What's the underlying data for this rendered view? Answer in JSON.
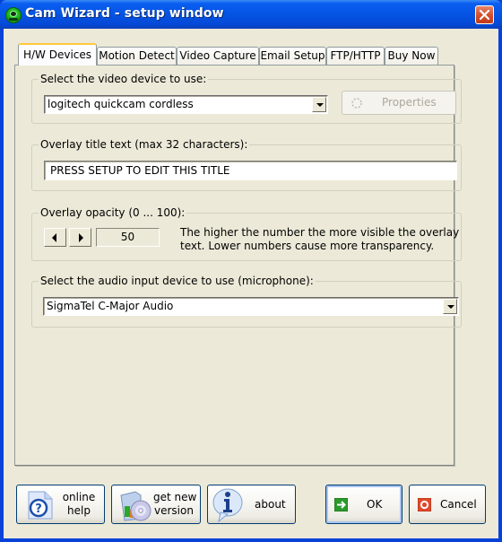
{
  "window": {
    "title": "Cam Wizard - setup window",
    "app_icon": "webcam-icon",
    "close_icon": "close-icon"
  },
  "tabs": [
    {
      "label": "H/W Devices",
      "active": true
    },
    {
      "label": "Motion Detect",
      "active": false
    },
    {
      "label": "Video Capture",
      "active": false
    },
    {
      "label": "Email Setup",
      "active": false
    },
    {
      "label": "FTP/HTTP",
      "active": false
    },
    {
      "label": "Buy Now",
      "active": false
    }
  ],
  "video_device": {
    "label": "Select the video device to use:",
    "selected": "logitech quickcam cordless",
    "properties_label": "Properties",
    "properties_enabled": false
  },
  "overlay_title": {
    "label": "Overlay title text (max 32 characters):",
    "value": "PRESS SETUP TO EDIT THIS TITLE"
  },
  "overlay_opacity": {
    "label": "Overlay opacity (0 ... 100):",
    "value": "50",
    "hint_line1": "The higher the number the more visible the overlay",
    "hint_line2": "text. Lower numbers cause more transparency."
  },
  "audio_device": {
    "label": "Select the audio input device to use (microphone):",
    "selected": "SigmaTel C-Major Audio"
  },
  "buttons": {
    "online_help_line1": "online",
    "online_help_line2": "help",
    "get_new_version_line1": "get new",
    "get_new_version_line2": "version",
    "about": "about",
    "ok": "OK",
    "cancel": "Cancel"
  },
  "colors": {
    "titlebar": "#0554e3",
    "face": "#ece9d8",
    "ok_arrow": "#2a9a2a",
    "cancel_icon": "#e04a2a"
  }
}
